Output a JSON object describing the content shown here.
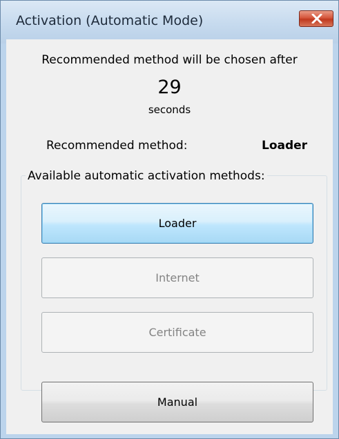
{
  "window": {
    "title": "Activation (Automatic Mode)",
    "close_icon": "close-icon"
  },
  "countdown": {
    "message": "Recommended method will be chosen after",
    "seconds_value": "29",
    "seconds_label": "seconds"
  },
  "recommended": {
    "label": "Recommended method:",
    "value": "Loader"
  },
  "methods_group": {
    "label": "Available automatic activation methods:",
    "buttons": [
      {
        "label": "Loader",
        "enabled": true,
        "focused": true
      },
      {
        "label": "Internet",
        "enabled": false
      },
      {
        "label": "Certificate",
        "enabled": false
      }
    ]
  },
  "manual_button": {
    "label": "Manual"
  },
  "colors": {
    "titlebar": "#c6daee",
    "close_button": "#c0391f",
    "focused_button_border": "#3c7fb1",
    "disabled_text": "#838383"
  }
}
